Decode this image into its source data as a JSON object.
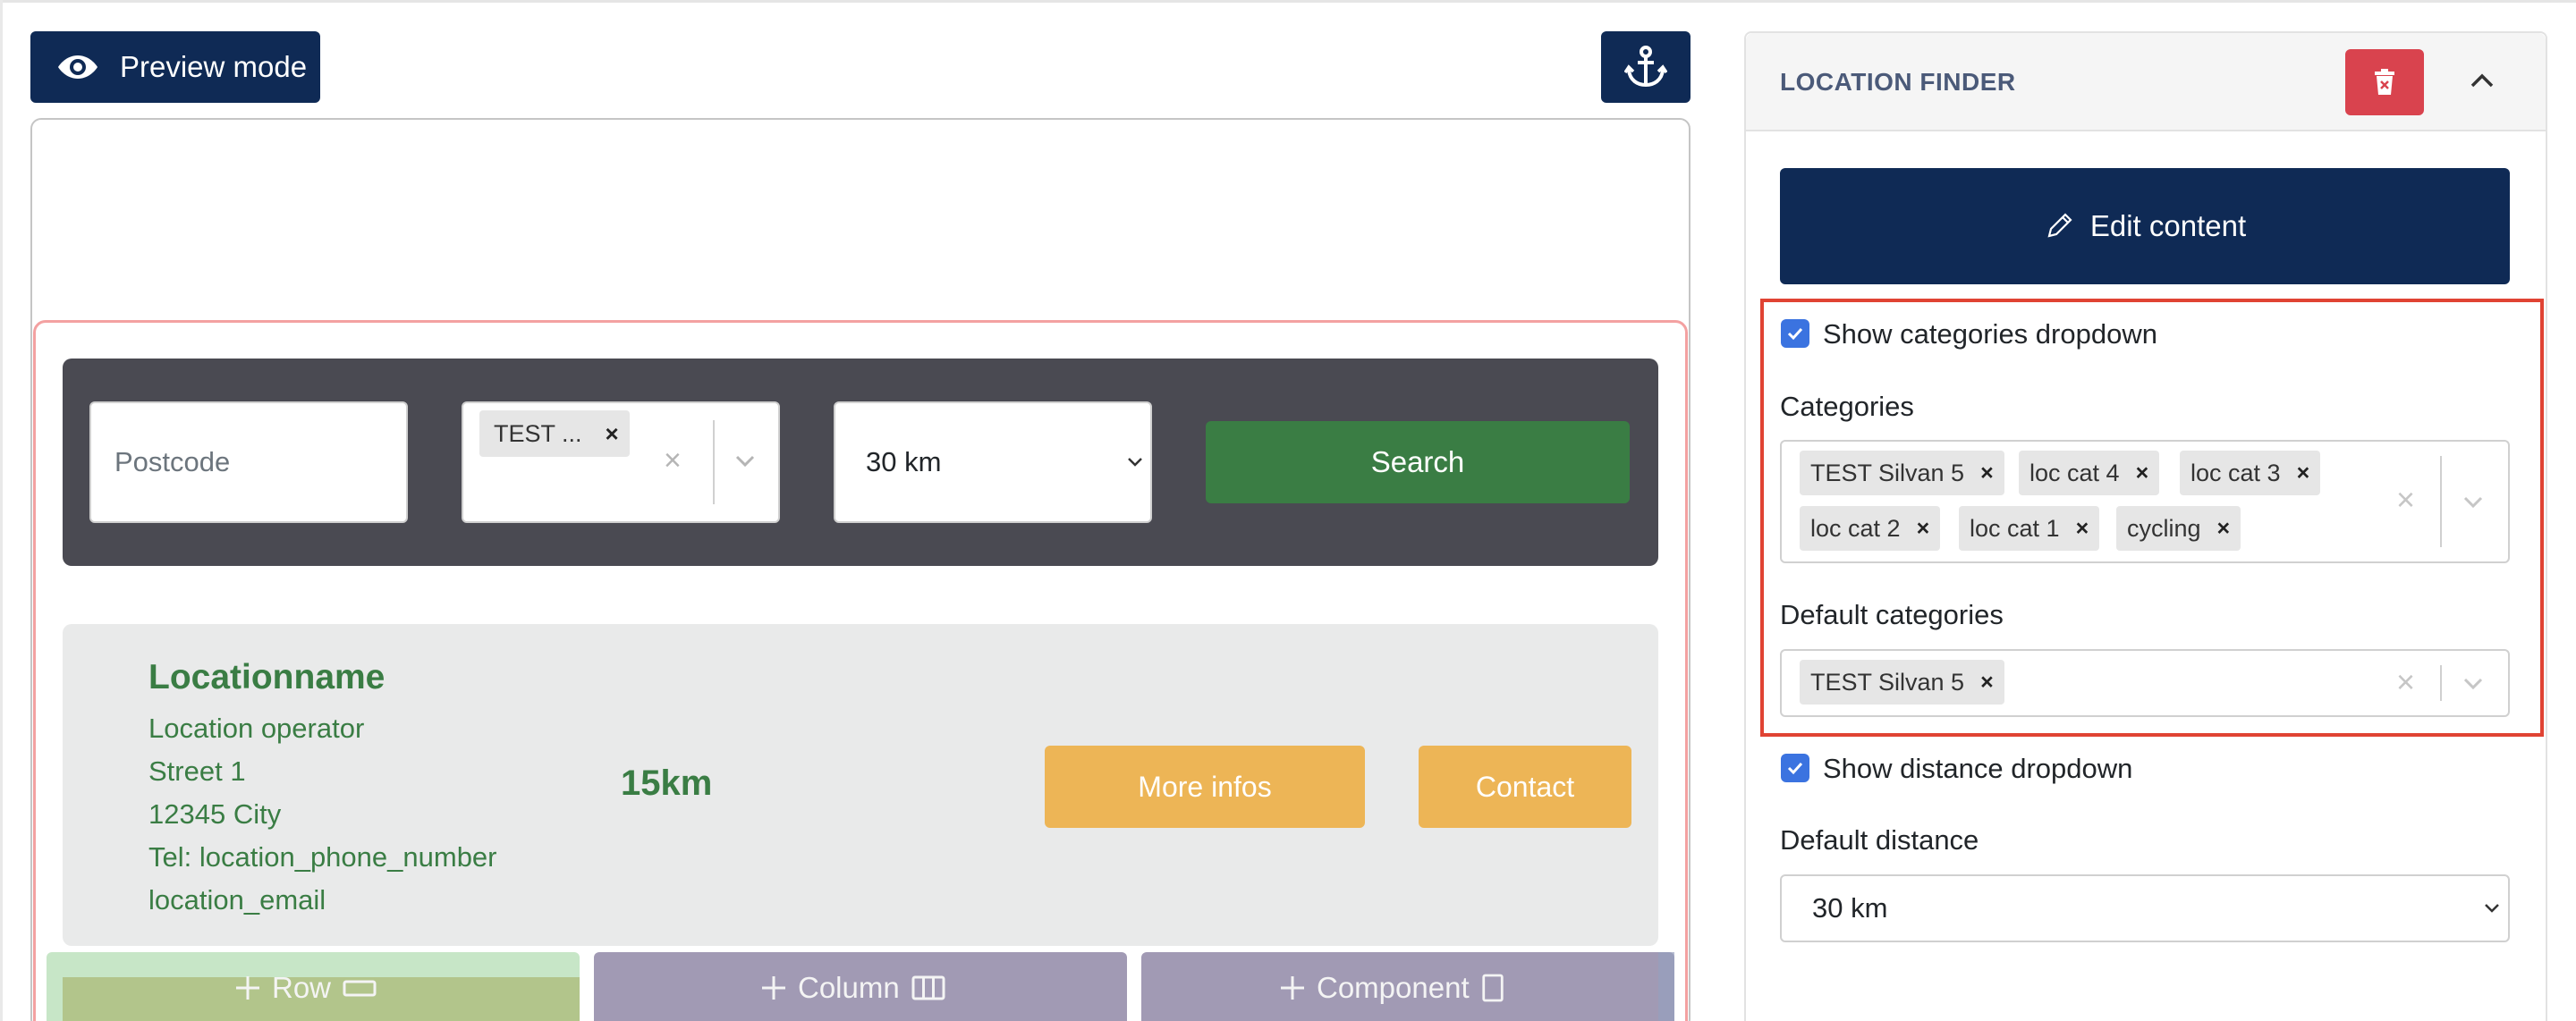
{
  "toolbar": {
    "preview_label": "Preview mode"
  },
  "canvas": {
    "search_bar": {
      "postcode_placeholder": "Postcode",
      "category_chip": "TEST ...",
      "chip_remove": "×",
      "clear_symbol": "×",
      "distance_value": "30 km",
      "search_label": "Search"
    },
    "location": {
      "name": "Locationname",
      "operator": "Location operator",
      "street": "Street 1",
      "city": "12345 City",
      "tel": "Tel: location_phone_number",
      "email": "location_email",
      "distance": "15km",
      "more_label": "More infos",
      "contact_label": "Contact"
    },
    "actions": {
      "row_label": "Row",
      "column_label": "Column",
      "component_label": "Component"
    }
  },
  "panel": {
    "title": "LOCATION FINDER",
    "edit_label": "Edit content",
    "show_categories_label": "Show categories dropdown",
    "show_categories_checked": true,
    "categories_label": "Categories",
    "categories": [
      "TEST Silvan 5",
      "loc cat 4",
      "loc cat 3",
      "loc cat 2",
      "loc cat 1",
      "cycling"
    ],
    "default_categories_label": "Default categories",
    "default_categories": [
      "TEST Silvan 5"
    ],
    "show_distance_label": "Show distance dropdown",
    "show_distance_checked": true,
    "default_distance_label": "Default distance",
    "default_distance_value": "30 km",
    "chip_remove": "×",
    "clear_symbol": "×"
  },
  "colors": {
    "navy": "#0f2a55",
    "green": "#3a7d44",
    "orange": "#edb556",
    "danger": "#d9434e",
    "highlight": "#e04333",
    "checkbox": "#3b73e0"
  }
}
